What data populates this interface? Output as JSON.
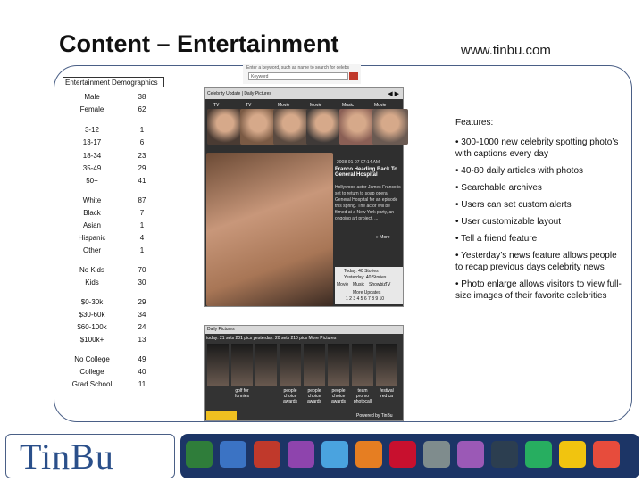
{
  "slide": {
    "title": "Content – Entertainment",
    "url": "www.tinbu.com"
  },
  "demographics": {
    "header": "Entertainment Demographics",
    "rows": [
      {
        "label": "Male",
        "value": "38"
      },
      {
        "label": "Female",
        "value": "62"
      },
      {
        "label": "3-12",
        "value": "1"
      },
      {
        "label": "13-17",
        "value": "6"
      },
      {
        "label": "18-34",
        "value": "23"
      },
      {
        "label": "35-49",
        "value": "29"
      },
      {
        "label": "50+",
        "value": "41"
      },
      {
        "label": "White",
        "value": "87"
      },
      {
        "label": "Black",
        "value": "7"
      },
      {
        "label": "Asian",
        "value": "1"
      },
      {
        "label": "Hispanic",
        "value": "4"
      },
      {
        "label": "Other",
        "value": "1"
      },
      {
        "label": "No Kids",
        "value": "70"
      },
      {
        "label": "Kids",
        "value": "30"
      },
      {
        "label": "$0-30k",
        "value": "29"
      },
      {
        "label": "$30-60k",
        "value": "34"
      },
      {
        "label": "$60-100k",
        "value": "24"
      },
      {
        "label": "$100k+",
        "value": "13"
      },
      {
        "label": "No College",
        "value": "49"
      },
      {
        "label": "College",
        "value": "40"
      },
      {
        "label": "Grad School",
        "value": "11"
      }
    ]
  },
  "screenshot": {
    "search_hint": "Enter a keyword, such as name to search for celebs",
    "search_placeholder": "Keyword",
    "tab_header": "Celebrity Update | Daily Pictures",
    "tabs": [
      "TV",
      "TV",
      "Movie",
      "Movie",
      "Music",
      "Movie"
    ],
    "article_date": "2008-01-07 07:14 AM",
    "article_title": "Franco Heading Back To General Hospital",
    "article_body": "Hollywood actor James Franco is set to return to soap opera General Hospital for an episode this spring. The actor will be filmed at a New York party, an ongoing art project. ...",
    "more": "» More",
    "today_stories": "Today: 40 Stories",
    "yesterday_stories": "Yesterday: 40 Stories",
    "sub_tabs": [
      "Movie",
      "Music",
      "Showbiz",
      "TV"
    ],
    "more_updates": "More Updates",
    "pager": "1 2 3 4 5 6 7 8 9 10"
  },
  "daily": {
    "header": "Daily Pictures",
    "row": "today: 21 sets 201 pics   yesterday: 20 sets 210 pics   More Pictures",
    "captions": [
      "",
      "golf for funnies",
      "",
      "people choice awards",
      "people choice awards",
      "people choice awards",
      "team promo photocall",
      "festival red ca"
    ],
    "brand": "Powered by TinBu"
  },
  "features": {
    "title": "Features:",
    "items": [
      "• 300-1000 new celebrity spotting photo’s with captions every day",
      "• 40-80 daily articles with photos",
      "• Searchable archives",
      "• Users can set custom alerts",
      "• User customizable layout",
      "• Tell a friend feature",
      "• Yesterday’s news feature allows people to recap previous days celebrity news",
      "• Photo enlarge allows visitors to view full-size images of their favorite celebrities"
    ]
  },
  "footer": {
    "logo": "TinBu",
    "icons": [
      "soccer-ball-icon",
      "chart-icon",
      "music-notes-icon",
      "billiard-ball-icon",
      "weather-icon",
      "speech-bubble-icon",
      "newspaper-icon",
      "person-icon",
      "bubble-icon",
      "joystick-icon",
      "chess-icon",
      "sudoku-icon",
      "basketball-icon"
    ]
  },
  "colors": {
    "frame": "#4a5f86",
    "iconbar": "#1c3566",
    "logo": "#2a4f8a"
  }
}
